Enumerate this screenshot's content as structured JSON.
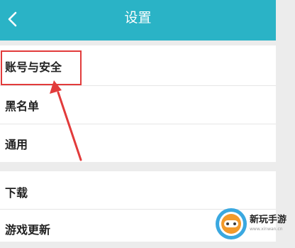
{
  "header": {
    "title": "设置",
    "back_icon": "chevron-left-icon"
  },
  "settings": [
    {
      "label": "账号与安全"
    },
    {
      "label": "黑名单"
    },
    {
      "label": "通用"
    },
    {
      "label": "下载"
    },
    {
      "label": "游戏更新"
    }
  ],
  "watermark": {
    "text": "新玩手游",
    "url": "www.xinwan.cn"
  },
  "colors": {
    "header": "#2ab3c6",
    "highlight": "#e23b3b",
    "background": "#ececec"
  }
}
